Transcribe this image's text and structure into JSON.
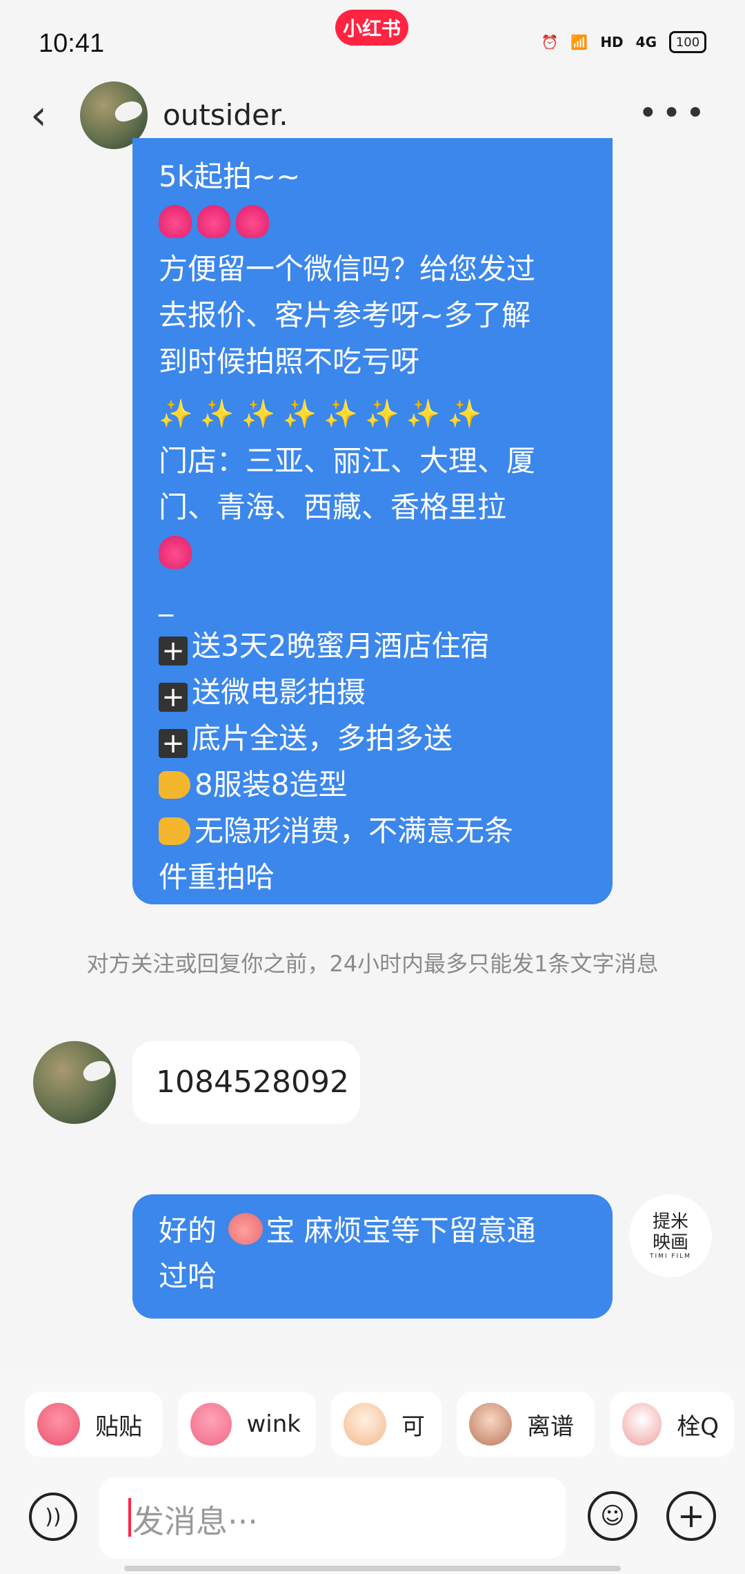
{
  "status": {
    "time": "10:41",
    "brand": "小红书",
    "net": "HD",
    "signal": "4G",
    "battery": "100"
  },
  "header": {
    "title": "outsider."
  },
  "big_message": {
    "lines": [
      "5k起拍~~",
      "",
      "方便留一个微信吗？给您发过",
      "去报价、客片参考呀~多了解",
      "到时候拍照不吃亏呀",
      "",
      "门店：三亚、丽江、大理、厦",
      "门、青海、西藏、香格里拉",
      "",
      "_",
      "送3天2晚蜜月酒店住宿",
      "送微电影拍摄",
      "底片全送，多拍多送",
      "8服装8造型",
      "无隐形消费，不满意无条",
      "件重拍哈"
    ]
  },
  "notice": "对方关注或回复你之前，24小时内最多只能发1条文字消息",
  "incoming": {
    "text": "1084528092"
  },
  "outgoing": {
    "text_part1": "好的 ",
    "text_part2": "宝  麻烦宝等下留意通",
    "text_part3": "过哈"
  },
  "self_avatar": {
    "line1": "提米",
    "line2": "映画",
    "line3": "TIMI FILM"
  },
  "chips": [
    "贴贴",
    "wink",
    "可",
    "离谱",
    "栓Q"
  ],
  "input": {
    "placeholder": "发消息···"
  },
  "icons": {
    "back": "back-icon",
    "more": "more-icon",
    "voice": "voice-icon",
    "emoji": "emoji-icon",
    "add": "add-icon"
  }
}
